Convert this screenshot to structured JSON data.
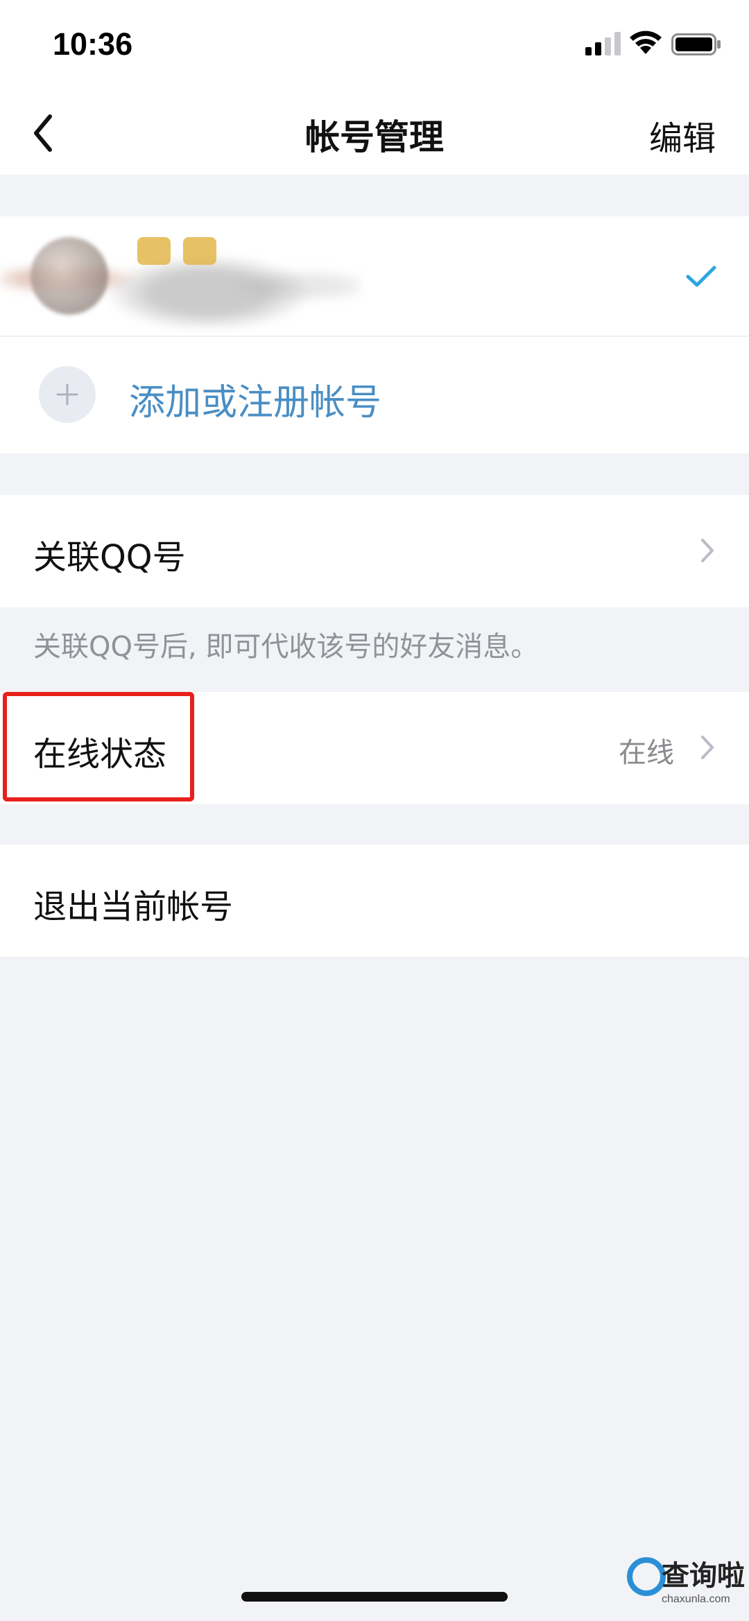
{
  "status_bar": {
    "time": "10:36",
    "icons": [
      "signal-icon",
      "wifi-icon",
      "battery-icon"
    ]
  },
  "nav": {
    "back_icon": "chevron-left-icon",
    "title": "帐号管理",
    "edit_label": "编辑"
  },
  "accounts": {
    "current_account_selected": true,
    "check_color": "#2aa7e0",
    "add_label": "添加或注册帐号"
  },
  "link_qq": {
    "label": "关联QQ号",
    "hint": "关联QQ号后, 即可代收该号的好友消息。"
  },
  "online_status": {
    "label": "在线状态",
    "value": "在线",
    "highlight_color": "#e8201c"
  },
  "logout": {
    "label": "退出当前帐号"
  },
  "watermark": {
    "title": "查询啦",
    "url": "chaxunla.com"
  }
}
